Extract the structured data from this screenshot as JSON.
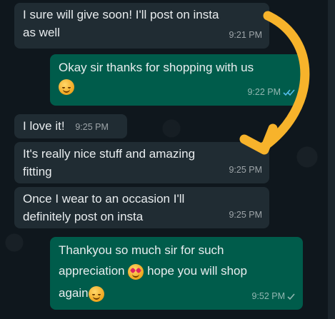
{
  "messages": [
    {
      "direction": "incoming",
      "text": "I sure will give soon! I'll post on insta as well",
      "line1": "I sure will give soon! I'll post on insta",
      "line2": "as well",
      "time": "9:21 PM"
    },
    {
      "direction": "outgoing",
      "text": "Okay sir thanks for shopping with us",
      "emoji": "smiling-blushing-emoji",
      "time": "9:22 PM",
      "status": "read"
    },
    {
      "direction": "incoming",
      "text": "I love it!",
      "time": "9:25 PM"
    },
    {
      "direction": "incoming",
      "line1": "It's really nice stuff and amazing",
      "line2": "fitting",
      "time": "9:25 PM"
    },
    {
      "direction": "incoming",
      "line1": "Once I wear to an occasion I'll",
      "line2": "definitely post on insta",
      "time": "9:25 PM"
    },
    {
      "direction": "outgoing",
      "line1": "Thankyou so much sir for such",
      "line2_a": "appreciation",
      "line2_emoji": "heart-eyes-emoji",
      "line2_b": "hope you will shop",
      "line3": "again",
      "line3_emoji": "smiling-blushing-emoji",
      "time": "9:52 PM",
      "status": "sent"
    }
  ],
  "colors": {
    "incoming_bubble": "#202c33",
    "outgoing_bubble": "#005c4b",
    "read_tick": "#53bdeb",
    "arrow": "#f7b32b"
  }
}
